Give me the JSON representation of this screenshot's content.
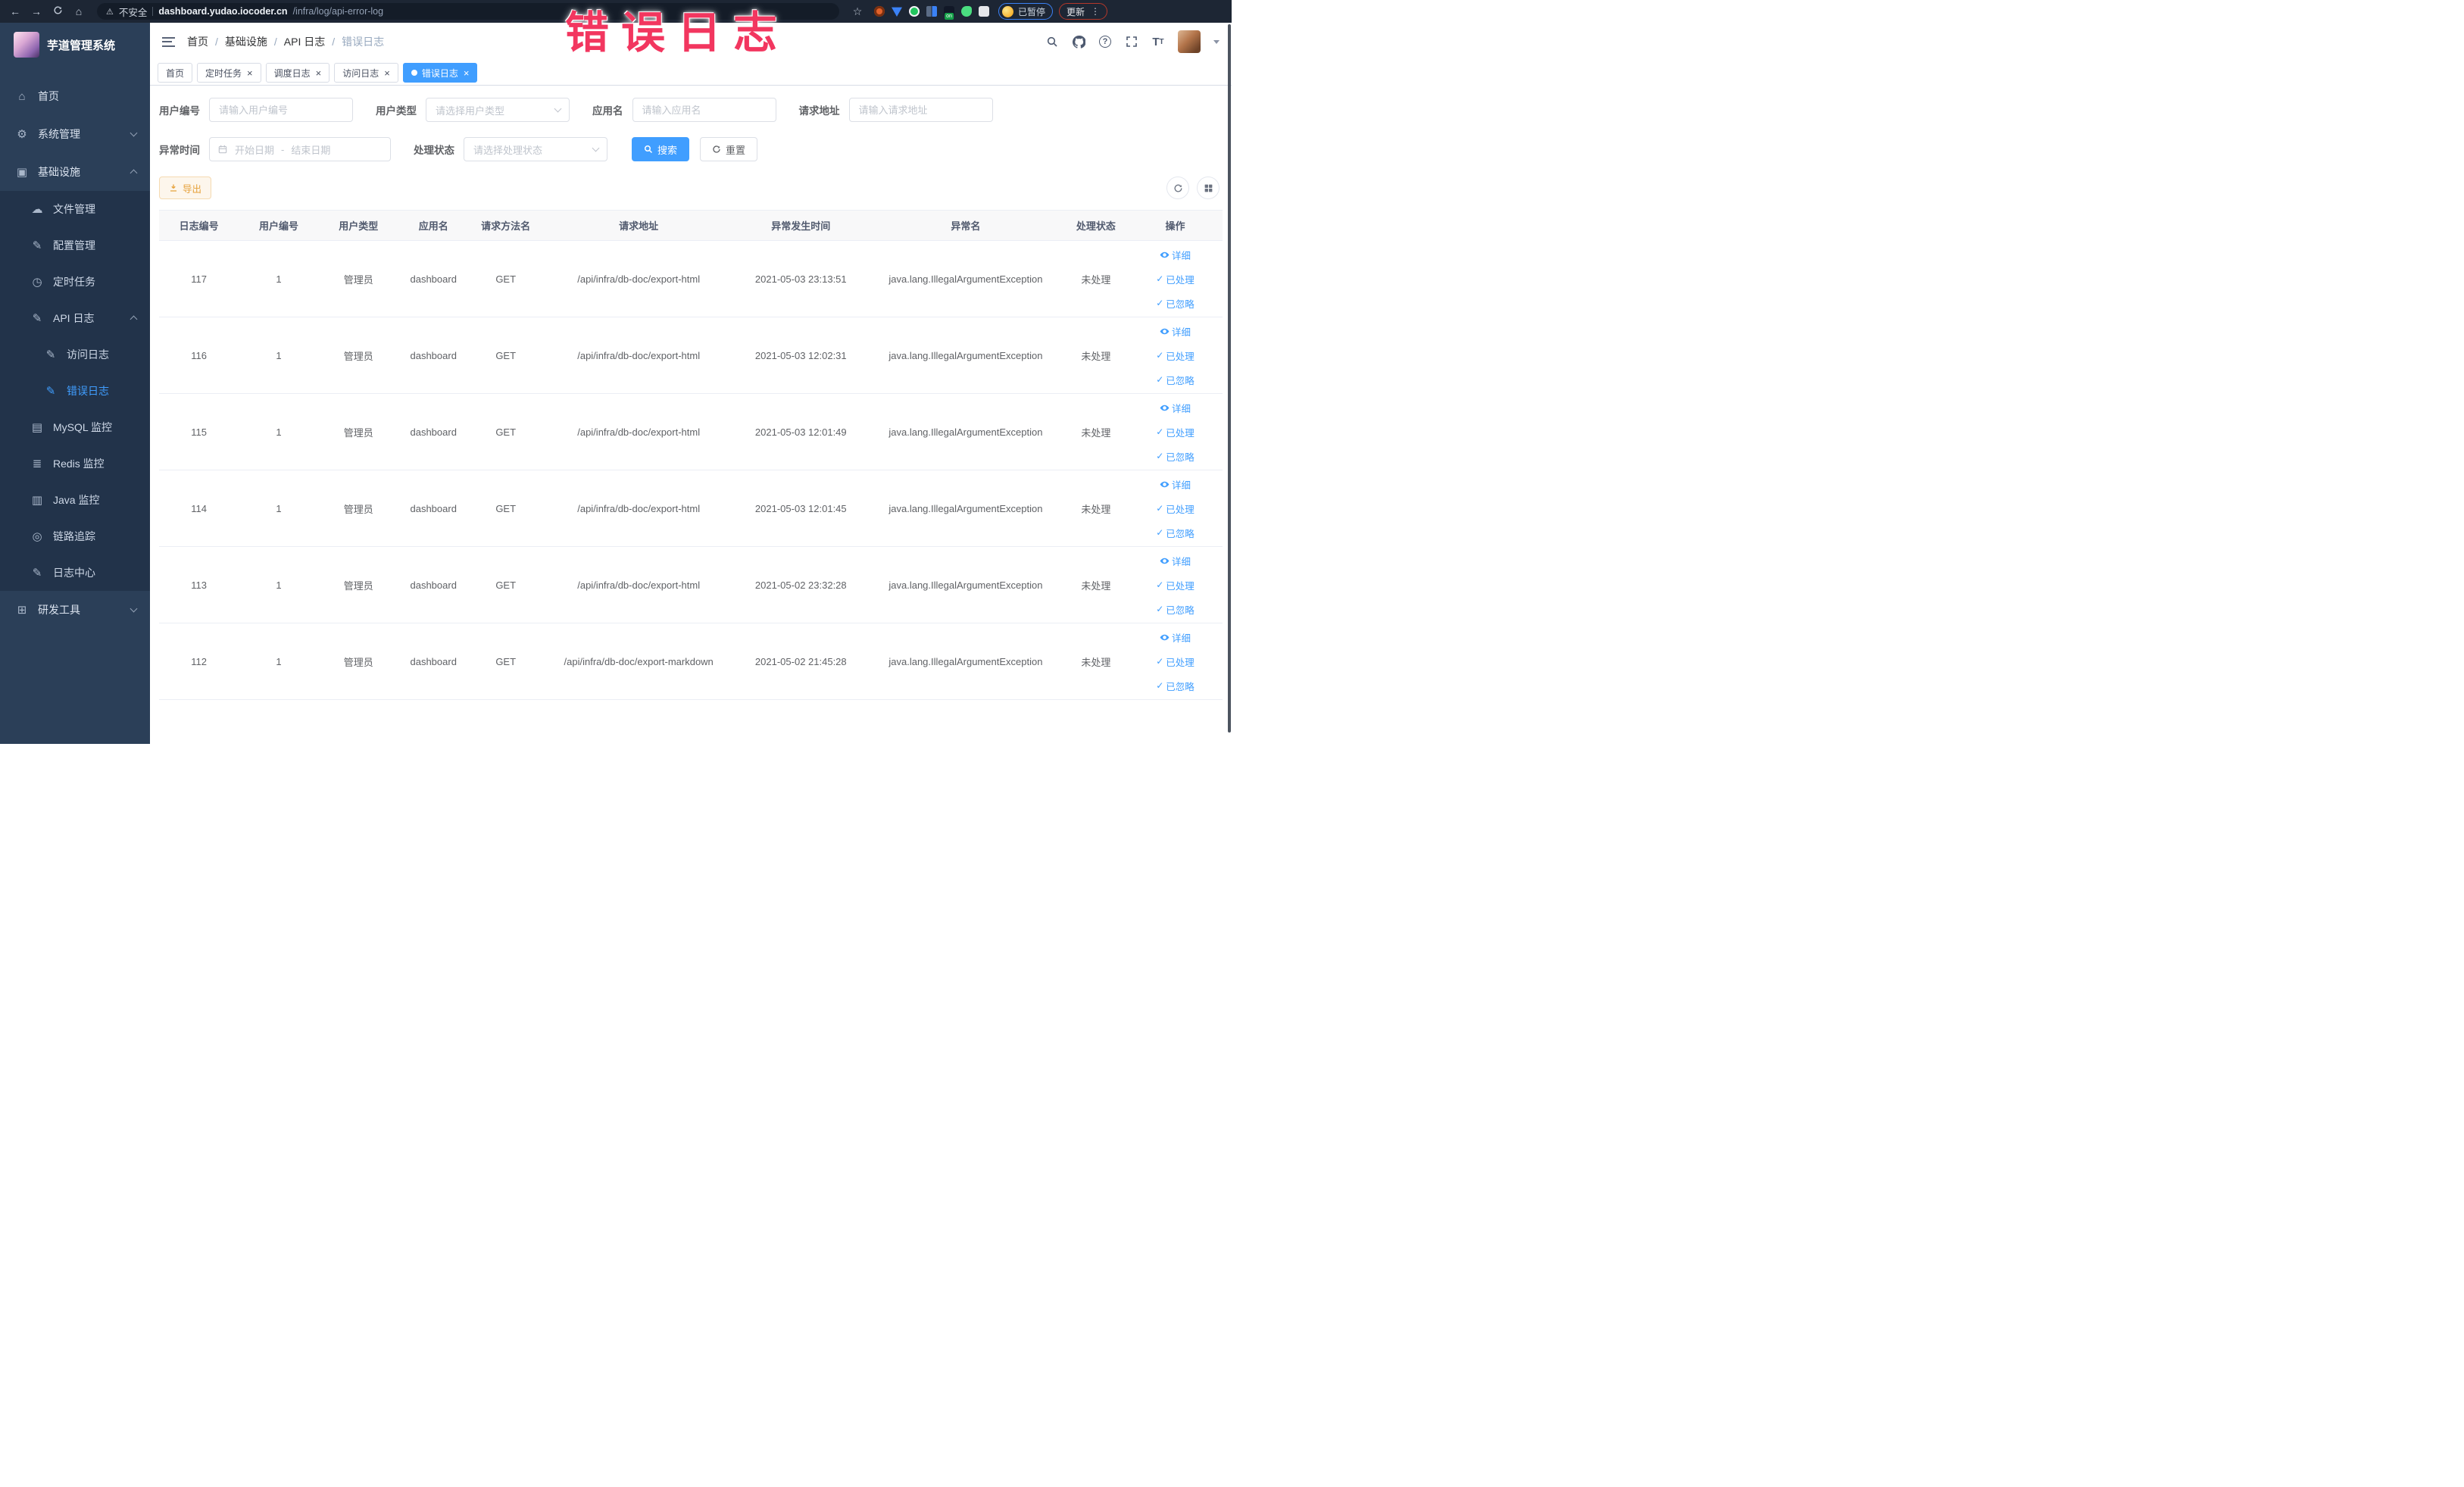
{
  "colors": {
    "accent": "#409eff",
    "warning": "#e6a23c",
    "watermark_red": "#f2365f",
    "sidebar_bg": "#2b3f58",
    "submenu_bg": "#22334a",
    "active_tab_bg": "#409eff"
  },
  "watermark_text": "错误日志",
  "browser": {
    "security_label": "不安全",
    "url_host": "dashboard.yudao.iocoder.cn",
    "url_path": "/infra/log/api-error-log",
    "extension_badge": "on",
    "paused_label": "已暂停",
    "update_label": "更新"
  },
  "sidebar": {
    "title": "芋道管理系统",
    "items": [
      {
        "label": "首页",
        "icon": "home-icon",
        "level": 0
      },
      {
        "label": "系统管理",
        "icon": "gear-icon",
        "level": 0,
        "chevron": "down"
      },
      {
        "label": "基础设施",
        "icon": "monitor-icon",
        "level": 0,
        "chevron": "up"
      },
      {
        "label": "文件管理",
        "icon": "cloud-icon",
        "level": 1
      },
      {
        "label": "配置管理",
        "icon": "edit-icon",
        "level": 1
      },
      {
        "label": "定时任务",
        "icon": "clock-icon",
        "level": 1
      },
      {
        "label": "API 日志",
        "icon": "log-icon",
        "level": 1,
        "chevron": "up"
      },
      {
        "label": "访问日志",
        "icon": "log-icon",
        "level": 2
      },
      {
        "label": "错误日志",
        "icon": "log-icon",
        "level": 2,
        "active": true
      },
      {
        "label": "MySQL 监控",
        "icon": "database-icon",
        "level": 1
      },
      {
        "label": "Redis 监控",
        "icon": "redis-icon",
        "level": 1
      },
      {
        "label": "Java 监控",
        "icon": "java-icon",
        "level": 1
      },
      {
        "label": "链路追踪",
        "icon": "trace-icon",
        "level": 1
      },
      {
        "label": "日志中心",
        "icon": "log-center-icon",
        "level": 1
      },
      {
        "label": "研发工具",
        "icon": "tools-icon",
        "level": 0,
        "chevron": "down"
      }
    ]
  },
  "header": {
    "breadcrumbs": [
      "首页",
      "基础设施",
      "API 日志",
      "错误日志"
    ]
  },
  "tabs": [
    {
      "label": "首页",
      "closable": false,
      "active": false
    },
    {
      "label": "定时任务",
      "closable": true,
      "active": false
    },
    {
      "label": "调度日志",
      "closable": true,
      "active": false
    },
    {
      "label": "访问日志",
      "closable": true,
      "active": false
    },
    {
      "label": "错误日志",
      "closable": true,
      "active": true
    }
  ],
  "filters": {
    "user_id_label": "用户编号",
    "user_id_placeholder": "请输入用户编号",
    "user_type_label": "用户类型",
    "user_type_placeholder": "请选择用户类型",
    "app_name_label": "应用名",
    "app_name_placeholder": "请输入应用名",
    "request_url_label": "请求地址",
    "request_url_placeholder": "请输入请求地址",
    "exception_time_label": "异常时间",
    "date_start_placeholder": "开始日期",
    "date_separator": "-",
    "date_end_placeholder": "结束日期",
    "process_status_label": "处理状态",
    "process_status_placeholder": "请选择处理状态",
    "search_label": "搜索",
    "reset_label": "重置"
  },
  "toolbar": {
    "export_label": "导出"
  },
  "table": {
    "columns": [
      "日志编号",
      "用户编号",
      "用户类型",
      "应用名",
      "请求方法名",
      "请求地址",
      "异常发生时间",
      "异常名",
      "处理状态",
      "操作"
    ],
    "action_labels": [
      "详细",
      "已处理",
      "已忽略"
    ],
    "rows": [
      {
        "log_id": "117",
        "user_id": "1",
        "user_type": "管理员",
        "app_name": "dashboard",
        "method": "GET",
        "url": "/api/infra/db-doc/export-html",
        "time": "2021-05-03 23:13:51",
        "exception": "java.lang.IllegalArgumentException",
        "status": "未处理"
      },
      {
        "log_id": "116",
        "user_id": "1",
        "user_type": "管理员",
        "app_name": "dashboard",
        "method": "GET",
        "url": "/api/infra/db-doc/export-html",
        "time": "2021-05-03 12:02:31",
        "exception": "java.lang.IllegalArgumentException",
        "status": "未处理"
      },
      {
        "log_id": "115",
        "user_id": "1",
        "user_type": "管理员",
        "app_name": "dashboard",
        "method": "GET",
        "url": "/api/infra/db-doc/export-html",
        "time": "2021-05-03 12:01:49",
        "exception": "java.lang.IllegalArgumentException",
        "status": "未处理"
      },
      {
        "log_id": "114",
        "user_id": "1",
        "user_type": "管理员",
        "app_name": "dashboard",
        "method": "GET",
        "url": "/api/infra/db-doc/export-html",
        "time": "2021-05-03 12:01:45",
        "exception": "java.lang.IllegalArgumentException",
        "status": "未处理"
      },
      {
        "log_id": "113",
        "user_id": "1",
        "user_type": "管理员",
        "app_name": "dashboard",
        "method": "GET",
        "url": "/api/infra/db-doc/export-html",
        "time": "2021-05-02 23:32:28",
        "exception": "java.lang.IllegalArgumentException",
        "status": "未处理"
      },
      {
        "log_id": "112",
        "user_id": "1",
        "user_type": "管理员",
        "app_name": "dashboard",
        "method": "GET",
        "url": "/api/infra/db-doc/export-markdown",
        "time": "2021-05-02 21:45:28",
        "exception": "java.lang.IllegalArgumentException",
        "status": "未处理"
      }
    ]
  }
}
